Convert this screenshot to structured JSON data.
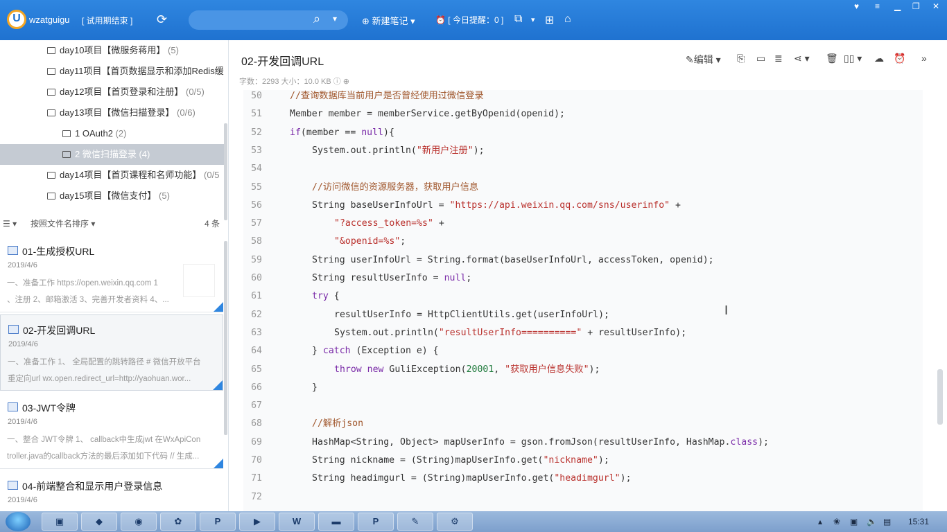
{
  "app": {
    "username": "wzatguigu",
    "trial_label": "[ 试用期结束 ]",
    "new_note_label": "新建笔记",
    "reminder_label": "[ 今日提醒：0 ]"
  },
  "tree": [
    {
      "label": "day10项目【微服务蒋用】",
      "count": "(5)",
      "indent": 1
    },
    {
      "label": "day11项目【首页数据显示和添加Redis缓",
      "count": "",
      "indent": 1
    },
    {
      "label": "day12项目【首页登录和注册】",
      "count": "(0/5)",
      "indent": 1
    },
    {
      "label": "day13项目【微信扫描登录】",
      "count": "(0/6)",
      "indent": 1
    },
    {
      "label": "1 OAuth2",
      "count": "(2)",
      "indent": 2
    },
    {
      "label": "2 微信扫描登录",
      "count": "(4)",
      "indent": 2,
      "selected": true
    },
    {
      "label": "day14项目【首页课程和名师功能】",
      "count": "(0/5",
      "indent": 1
    },
    {
      "label": "day15项目【微信支付】",
      "count": "(5)",
      "indent": 1
    }
  ],
  "sort": {
    "label": "按照文件名排序",
    "count": "4 条"
  },
  "notes": [
    {
      "title": "01-生成授权URL",
      "date": "2019/4/6",
      "snippet1": "一、准备工作 https://open.weixin.qq.com 1",
      "snippet2": "、注册 2、邮箱激活 3、完善开发者资料 4、...",
      "thumb": true
    },
    {
      "title": "02-开发回调URL",
      "date": "2019/4/6",
      "snippet1": "一、准备工作 1、 全局配置的跳转路径 # 微信开放平台",
      "snippet2": "重定向url wx.open.redirect_url=http://yaohuan.wor...",
      "active": true
    },
    {
      "title": "03-JWT令牌",
      "date": "2019/4/6",
      "snippet1": "一、整合 JWT令牌 1、 callback中生成jwt 在WxApiCon",
      "snippet2": "troller.java的callback方法的最后添加如下代码 // 生成..."
    },
    {
      "title": "04-前端整合和显示用户登录信息",
      "date": "2019/4/6",
      "snippet1": "",
      "snippet2": ""
    }
  ],
  "main": {
    "title": "02-开发回调URL",
    "edit_label": "编辑",
    "meta": "字数：2293   大小：10.0 KB"
  },
  "code": [
    {
      "n": "50",
      "indent": 2,
      "parts": [
        [
          "c",
          "//查询数据库当前用户是否曾经使用过微信登录"
        ]
      ]
    },
    {
      "n": "51",
      "indent": 2,
      "parts": [
        [
          "t",
          "Member member = memberService.getByOpenid(openid);"
        ]
      ]
    },
    {
      "n": "52",
      "indent": 2,
      "parts": [
        [
          "k",
          "if"
        ],
        [
          "t",
          "(member == "
        ],
        [
          "k",
          "null"
        ],
        [
          "t",
          "){"
        ]
      ]
    },
    {
      "n": "53",
      "indent": 3,
      "parts": [
        [
          "t",
          "System.out.println("
        ],
        [
          "s",
          "\"新用户注册\""
        ],
        [
          "t",
          ");"
        ]
      ]
    },
    {
      "n": "54",
      "indent": 0,
      "parts": []
    },
    {
      "n": "55",
      "indent": 3,
      "parts": [
        [
          "c",
          "//访问微信的资源服务器，获取用户信息"
        ]
      ]
    },
    {
      "n": "56",
      "indent": 3,
      "parts": [
        [
          "t",
          "String baseUserInfoUrl = "
        ],
        [
          "s",
          "\"https://api.weixin.qq.com/sns/userinfo\""
        ],
        [
          "t",
          " +"
        ]
      ]
    },
    {
      "n": "57",
      "indent": 4,
      "parts": [
        [
          "s",
          "\"?access_token=%s\""
        ],
        [
          "t",
          " +"
        ]
      ]
    },
    {
      "n": "58",
      "indent": 4,
      "parts": [
        [
          "s",
          "\"&openid=%s\""
        ],
        [
          "t",
          ";"
        ]
      ]
    },
    {
      "n": "59",
      "indent": 3,
      "parts": [
        [
          "t",
          "String userInfoUrl = String.format(baseUserInfoUrl, accessToken, openid);"
        ]
      ]
    },
    {
      "n": "60",
      "indent": 3,
      "parts": [
        [
          "t",
          "String resultUserInfo = "
        ],
        [
          "k",
          "null"
        ],
        [
          "t",
          ";"
        ]
      ]
    },
    {
      "n": "61",
      "indent": 3,
      "parts": [
        [
          "k",
          "try"
        ],
        [
          "t",
          " {"
        ]
      ]
    },
    {
      "n": "62",
      "indent": 4,
      "parts": [
        [
          "t",
          "resultUserInfo = HttpClientUtils.get(userInfoUrl);"
        ]
      ]
    },
    {
      "n": "63",
      "indent": 4,
      "parts": [
        [
          "t",
          "System.out.println("
        ],
        [
          "s",
          "\"resultUserInfo==========\""
        ],
        [
          "t",
          " + resultUserInfo);"
        ]
      ]
    },
    {
      "n": "64",
      "indent": 3,
      "parts": [
        [
          "t",
          "} "
        ],
        [
          "k",
          "catch"
        ],
        [
          "t",
          " (Exception e) {"
        ]
      ]
    },
    {
      "n": "65",
      "indent": 4,
      "parts": [
        [
          "k",
          "throw new"
        ],
        [
          "t",
          " GuliException("
        ],
        [
          "n",
          "20001"
        ],
        [
          "t",
          ", "
        ],
        [
          "s",
          "\"获取用户信息失败\""
        ],
        [
          "t",
          ");"
        ]
      ]
    },
    {
      "n": "66",
      "indent": 3,
      "parts": [
        [
          "t",
          "}"
        ]
      ]
    },
    {
      "n": "67",
      "indent": 0,
      "parts": []
    },
    {
      "n": "68",
      "indent": 3,
      "parts": [
        [
          "c",
          "//解析json"
        ]
      ]
    },
    {
      "n": "69",
      "indent": 3,
      "parts": [
        [
          "t",
          "HashMap<String, Object> mapUserInfo = gson.fromJson(resultUserInfo, HashMap."
        ],
        [
          "k",
          "class"
        ],
        [
          "t",
          ");"
        ]
      ]
    },
    {
      "n": "70",
      "indent": 3,
      "parts": [
        [
          "t",
          "String nickname = (String)mapUserInfo.get("
        ],
        [
          "s",
          "\"nickname\""
        ],
        [
          "t",
          ");"
        ]
      ]
    },
    {
      "n": "71",
      "indent": 3,
      "parts": [
        [
          "t",
          "String headimgurl = (String)mapUserInfo.get("
        ],
        [
          "s",
          "\"headimgurl\""
        ],
        [
          "t",
          ");"
        ]
      ]
    },
    {
      "n": "72",
      "indent": 0,
      "parts": []
    }
  ],
  "taskbar": {
    "clock": "15:31",
    "apps": [
      "IntelliJ IDEA",
      "VS Code",
      "Browser",
      "Settings",
      "Notes P",
      "Remote",
      "WizNote",
      "Console",
      "Notes P2",
      "Paint",
      "Tools"
    ]
  },
  "colors": {
    "brand": "#1f72d0",
    "selected_row": "#c5cbd3",
    "comment": "#a0562c",
    "string": "#b9302c",
    "keyword": "#7a2ba8"
  }
}
